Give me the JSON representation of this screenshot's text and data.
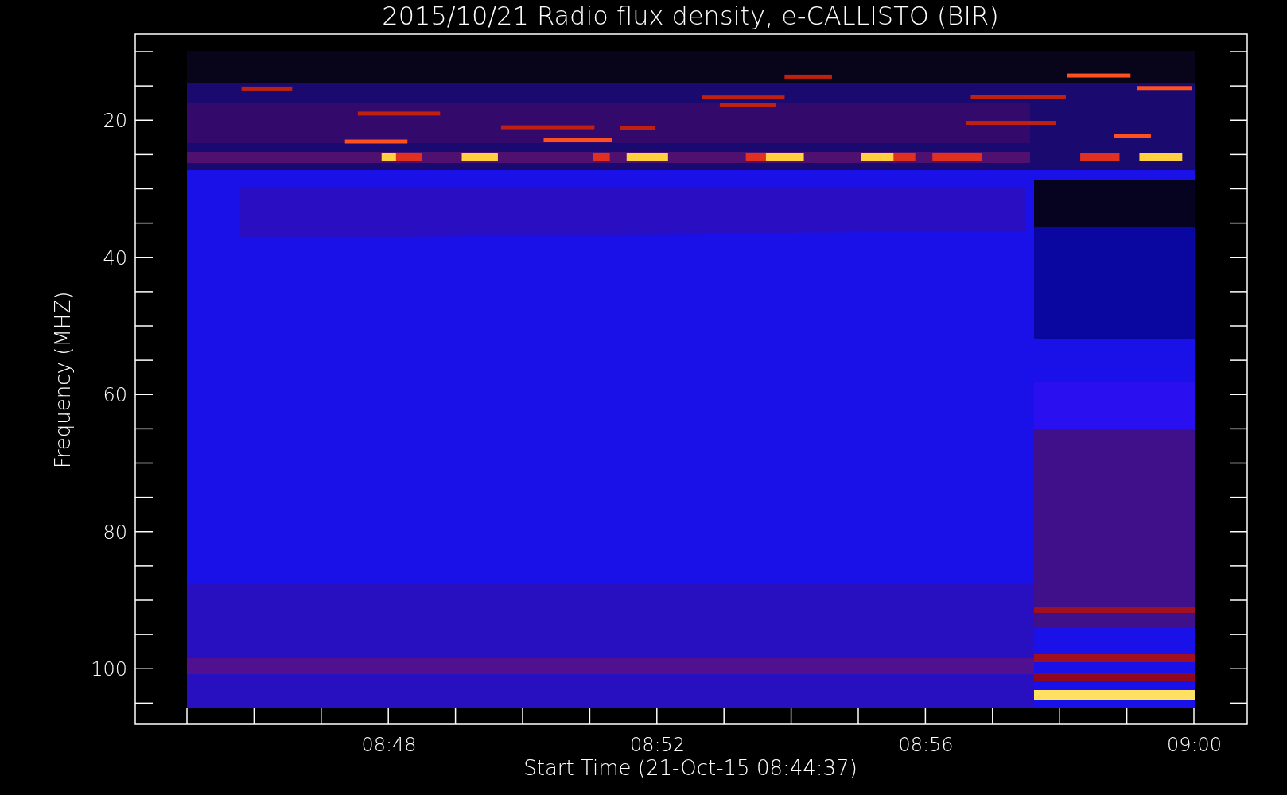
{
  "title": "2015/10/21  Radio flux density, e-CALLISTO (BIR)",
  "plot": {
    "ylabel": "Frequency (MHZ)",
    "xlabel": "Start Time (21-Oct-15 08:44:37)",
    "yticks": [
      "20",
      "40",
      "60",
      "80",
      "100"
    ],
    "xticks": [
      "08:48",
      "08:52",
      "08:56",
      "09:00"
    ]
  }
}
